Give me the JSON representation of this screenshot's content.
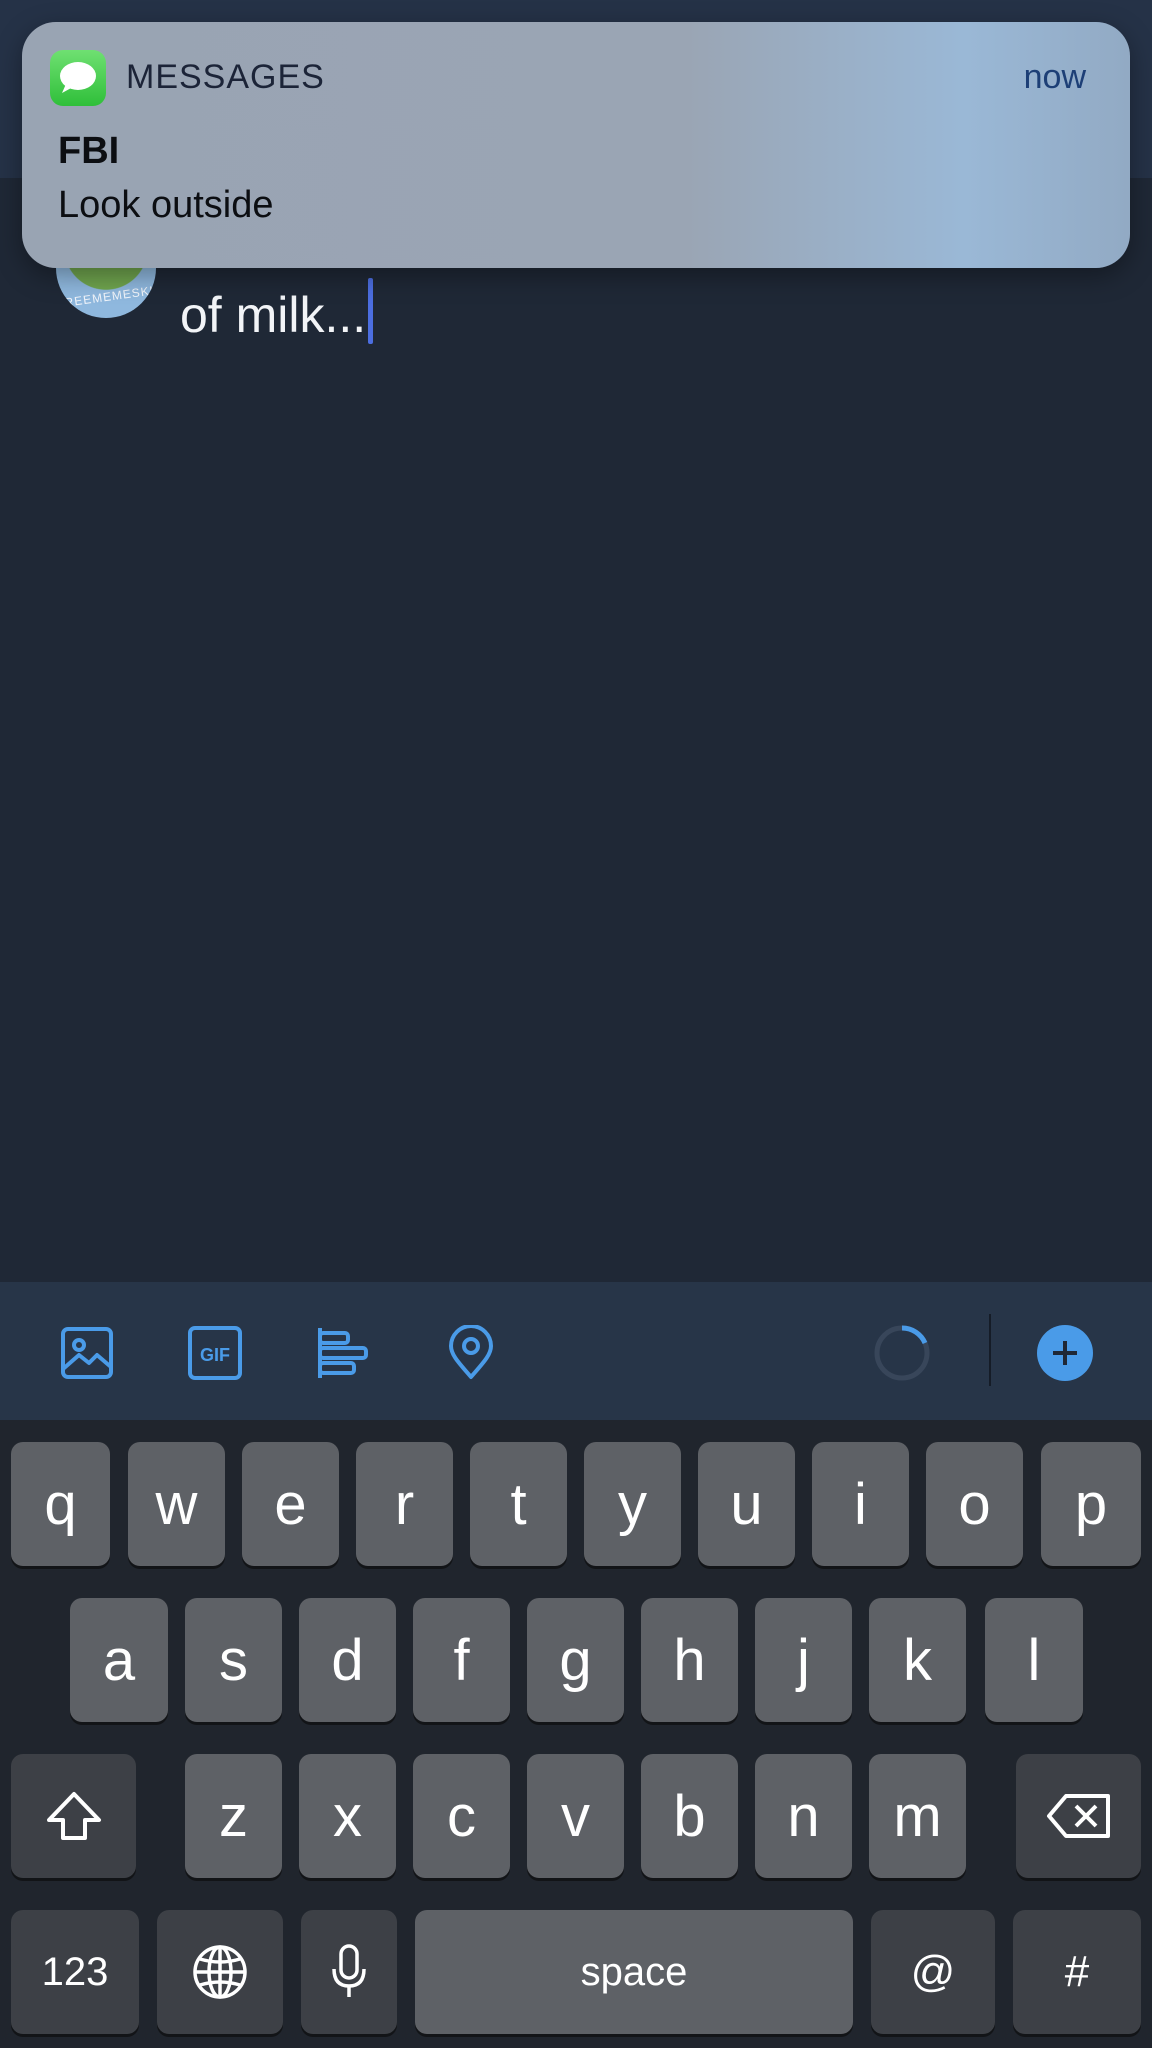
{
  "notification": {
    "app_name": "MESSAGES",
    "time": "now",
    "title": "FBI",
    "body": "Look outside"
  },
  "compose": {
    "text": "of milk...",
    "avatar_caption": "FREEMEMESKIDS"
  },
  "toolbar": {
    "icons": [
      "image-icon",
      "gif-icon",
      "poll-icon",
      "location-icon",
      "progress-ring",
      "add-icon"
    ],
    "gif_label": "GIF"
  },
  "keyboard": {
    "row1": [
      "q",
      "w",
      "e",
      "r",
      "t",
      "y",
      "u",
      "i",
      "o",
      "p"
    ],
    "row2": [
      "a",
      "s",
      "d",
      "f",
      "g",
      "h",
      "j",
      "k",
      "l"
    ],
    "row3": [
      "z",
      "x",
      "c",
      "v",
      "b",
      "n",
      "m"
    ],
    "numbers_label": "123",
    "space_label": "space",
    "at_label": "@",
    "hash_label": "#"
  },
  "colors": {
    "accent": "#4a9be8",
    "background": "#1f2836",
    "toolbar": "#273548"
  }
}
